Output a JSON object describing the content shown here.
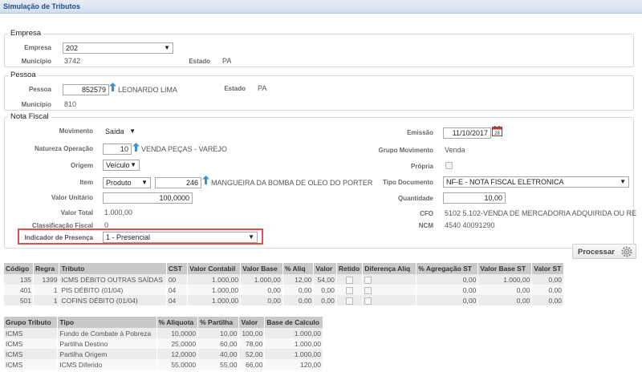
{
  "title": "Simulação de Tributos",
  "empresa": {
    "legend": "Empresa",
    "empresa_label": "Empresa",
    "empresa_value": "202",
    "municipio_label": "Município",
    "municipio_value": "3742",
    "estado_label": "Estado",
    "estado_value": "PA"
  },
  "pessoa": {
    "legend": "Pessoa",
    "pessoa_label": "Pessoa",
    "pessoa_code": "852579",
    "pessoa_name": "LEONARDO LIMA",
    "estado_label": "Estado",
    "estado_value": "PA",
    "municipio_label": "Município",
    "municipio_value": "810"
  },
  "nota": {
    "legend": "Nota Fiscal",
    "movimento_label": "Movimento",
    "movimento_value": "Saída",
    "natureza_label": "Natureza Operação",
    "natureza_code": "10",
    "natureza_desc": "VENDA PEÇAS - VAREJO",
    "origem_label": "Origem",
    "origem_value": "Veículo",
    "item_label": "Item",
    "item_type": "Produto",
    "item_code": "246",
    "item_desc": "MANGUEIRA DA BOMBA DE OLEO DO PORTER",
    "valor_unitario_label": "Valor Unitário",
    "valor_unitario_value": "100,0000",
    "valor_total_label": "Valor Total",
    "valor_total_value": "1.000,00",
    "classificacao_label": "Classificação Fiscal",
    "classificacao_value": "0",
    "indicador_label": "Indicador de Presença",
    "indicador_value": "1 - Presencial",
    "emissao_label": "Emissão",
    "emissao_value": "11/10/2017",
    "grupo_mov_label": "Grupo Movimento",
    "grupo_mov_value": "Venda",
    "propria_label": "Própria",
    "tipo_doc_label": "Tipo Documento",
    "tipo_doc_value": "NF-E - NOTA FISCAL ELETRONICA",
    "quantidade_label": "Quantidade",
    "quantidade_value": "10,00",
    "cfo_label": "CFO",
    "cfo_value": "5102  5.102-VENDA DE MERCADORIA ADQUIRIDA OU RE",
    "ncm_label": "NCM",
    "ncm_value": "4540  40091290"
  },
  "processar_label": "Processar",
  "tributos": {
    "headers": [
      "Código",
      "Regra",
      "Tributo",
      "CST",
      "Valor Contabil",
      "Valor Base",
      "% Aliq",
      "Valor",
      "Retido",
      "Diferença Aliq",
      "% Agregação ST",
      "Valor Base ST",
      "Valor ST"
    ],
    "rows": [
      [
        "135",
        "1399",
        "ICMS DÉBITO OUTRAS SAÍDAS",
        "00",
        "1.000,00",
        "1.000,00",
        "12,00",
        "54,00",
        "",
        "",
        "0,00",
        "1.000,00",
        "0,00"
      ],
      [
        "401",
        "1",
        "PIS DÉBITO (01/04)",
        "04",
        "1.000,00",
        "0,00",
        "0,00",
        "0,00",
        "",
        "",
        "0,00",
        "0,00",
        "0,00"
      ],
      [
        "501",
        "1",
        "COFINS DÉBITO (01/04)",
        "04",
        "1.000,00",
        "0,00",
        "0,00",
        "0,00",
        "",
        "",
        "0,00",
        "0,00",
        "0,00"
      ]
    ]
  },
  "partilha": {
    "headers": [
      "Grupo Tributo",
      "Tipo",
      "% Aliquota",
      "% Partilha",
      "Valor",
      "Base de Calculo"
    ],
    "rows": [
      [
        "ICMS",
        "Fundo de Combate à Pobreza",
        "10,0000",
        "10,00",
        "100,00",
        "1.000,00"
      ],
      [
        "ICMS",
        "Partilha Destino",
        "25,0000",
        "60,00",
        "78,00",
        "1.000,00"
      ],
      [
        "ICMS",
        "Partilha Origem",
        "12,0000",
        "40,00",
        "52,00",
        "1.000,00"
      ],
      [
        "ICMS",
        "ICMS Diferido",
        "55,0000",
        "55,00",
        "66,00",
        "120,00"
      ]
    ]
  },
  "colors": {
    "accent": "#1f4e8c",
    "highlight": "#d9534f",
    "link_icon": "#3a8fd6"
  }
}
